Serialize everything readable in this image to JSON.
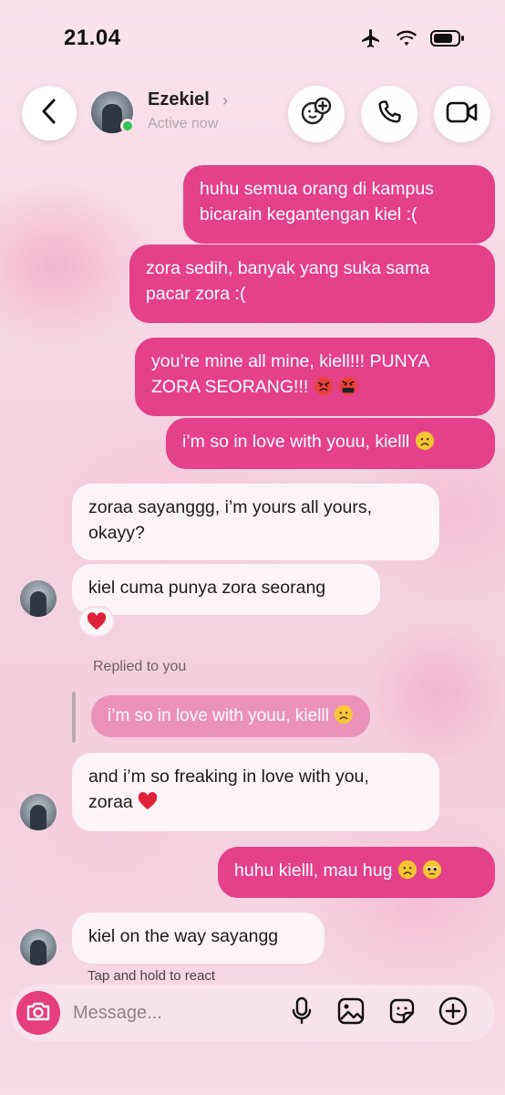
{
  "status_bar": {
    "time": "21.04",
    "icons": [
      "airplane-icon",
      "wifi-icon",
      "battery-icon"
    ]
  },
  "header": {
    "back_icon": "chevron-left-icon",
    "contact_name": "Ezekiel",
    "name_chevron": "›",
    "active_status": "Active now",
    "actions": [
      "effects-icon",
      "phone-icon",
      "video-icon"
    ]
  },
  "messages": [
    {
      "direction": "outgoing",
      "lines": [
        "huhu semua orang di kampus",
        "bicarain kegantengan kiel :("
      ]
    },
    {
      "direction": "outgoing",
      "lines": [
        "zora sedih, banyak yang suka sama",
        "pacar zora :("
      ]
    },
    {
      "direction": "outgoing",
      "lines": [
        "you’re mine all mine, kiell!!! PUNYA",
        "ZORA SEORANG!!!"
      ],
      "emojis": [
        "angry-face",
        "cursing-face"
      ]
    },
    {
      "direction": "outgoing",
      "lines": [
        "i’m so in love with youu, kielll"
      ],
      "emojis": [
        "frowning-face"
      ]
    },
    {
      "direction": "incoming",
      "lines": [
        "zoraa sayanggg, i’m yours all yours,",
        "okayy?"
      ]
    },
    {
      "direction": "incoming",
      "lines": [
        "kiel cuma punya zora seorang"
      ],
      "reaction": "red-heart"
    },
    {
      "direction": "incoming",
      "replied_label": "Replied to you",
      "quote": "i’m so in love with youu, kielll",
      "lines": [
        "and i’m so freaking in love with you,",
        "zoraa"
      ],
      "emojis": [
        "red-heart"
      ]
    },
    {
      "direction": "outgoing",
      "lines": [
        "huhu kielll, mau hug"
      ],
      "emojis": [
        "frowning-face",
        "pleading-face"
      ]
    },
    {
      "direction": "incoming",
      "lines": [
        "kiel on the way sayangg"
      ]
    }
  ],
  "hint": "Tap and hold to react",
  "composer": {
    "placeholder": "Message...",
    "icons": [
      "camera-icon",
      "microphone-icon",
      "gallery-icon",
      "sticker-icon",
      "add-icon"
    ]
  },
  "colors": {
    "outgoing_bubble": "#e5408a",
    "incoming_bubble": "#fdf4f7",
    "camera_button": "#e63d7c",
    "online_dot": "#2fc753"
  }
}
